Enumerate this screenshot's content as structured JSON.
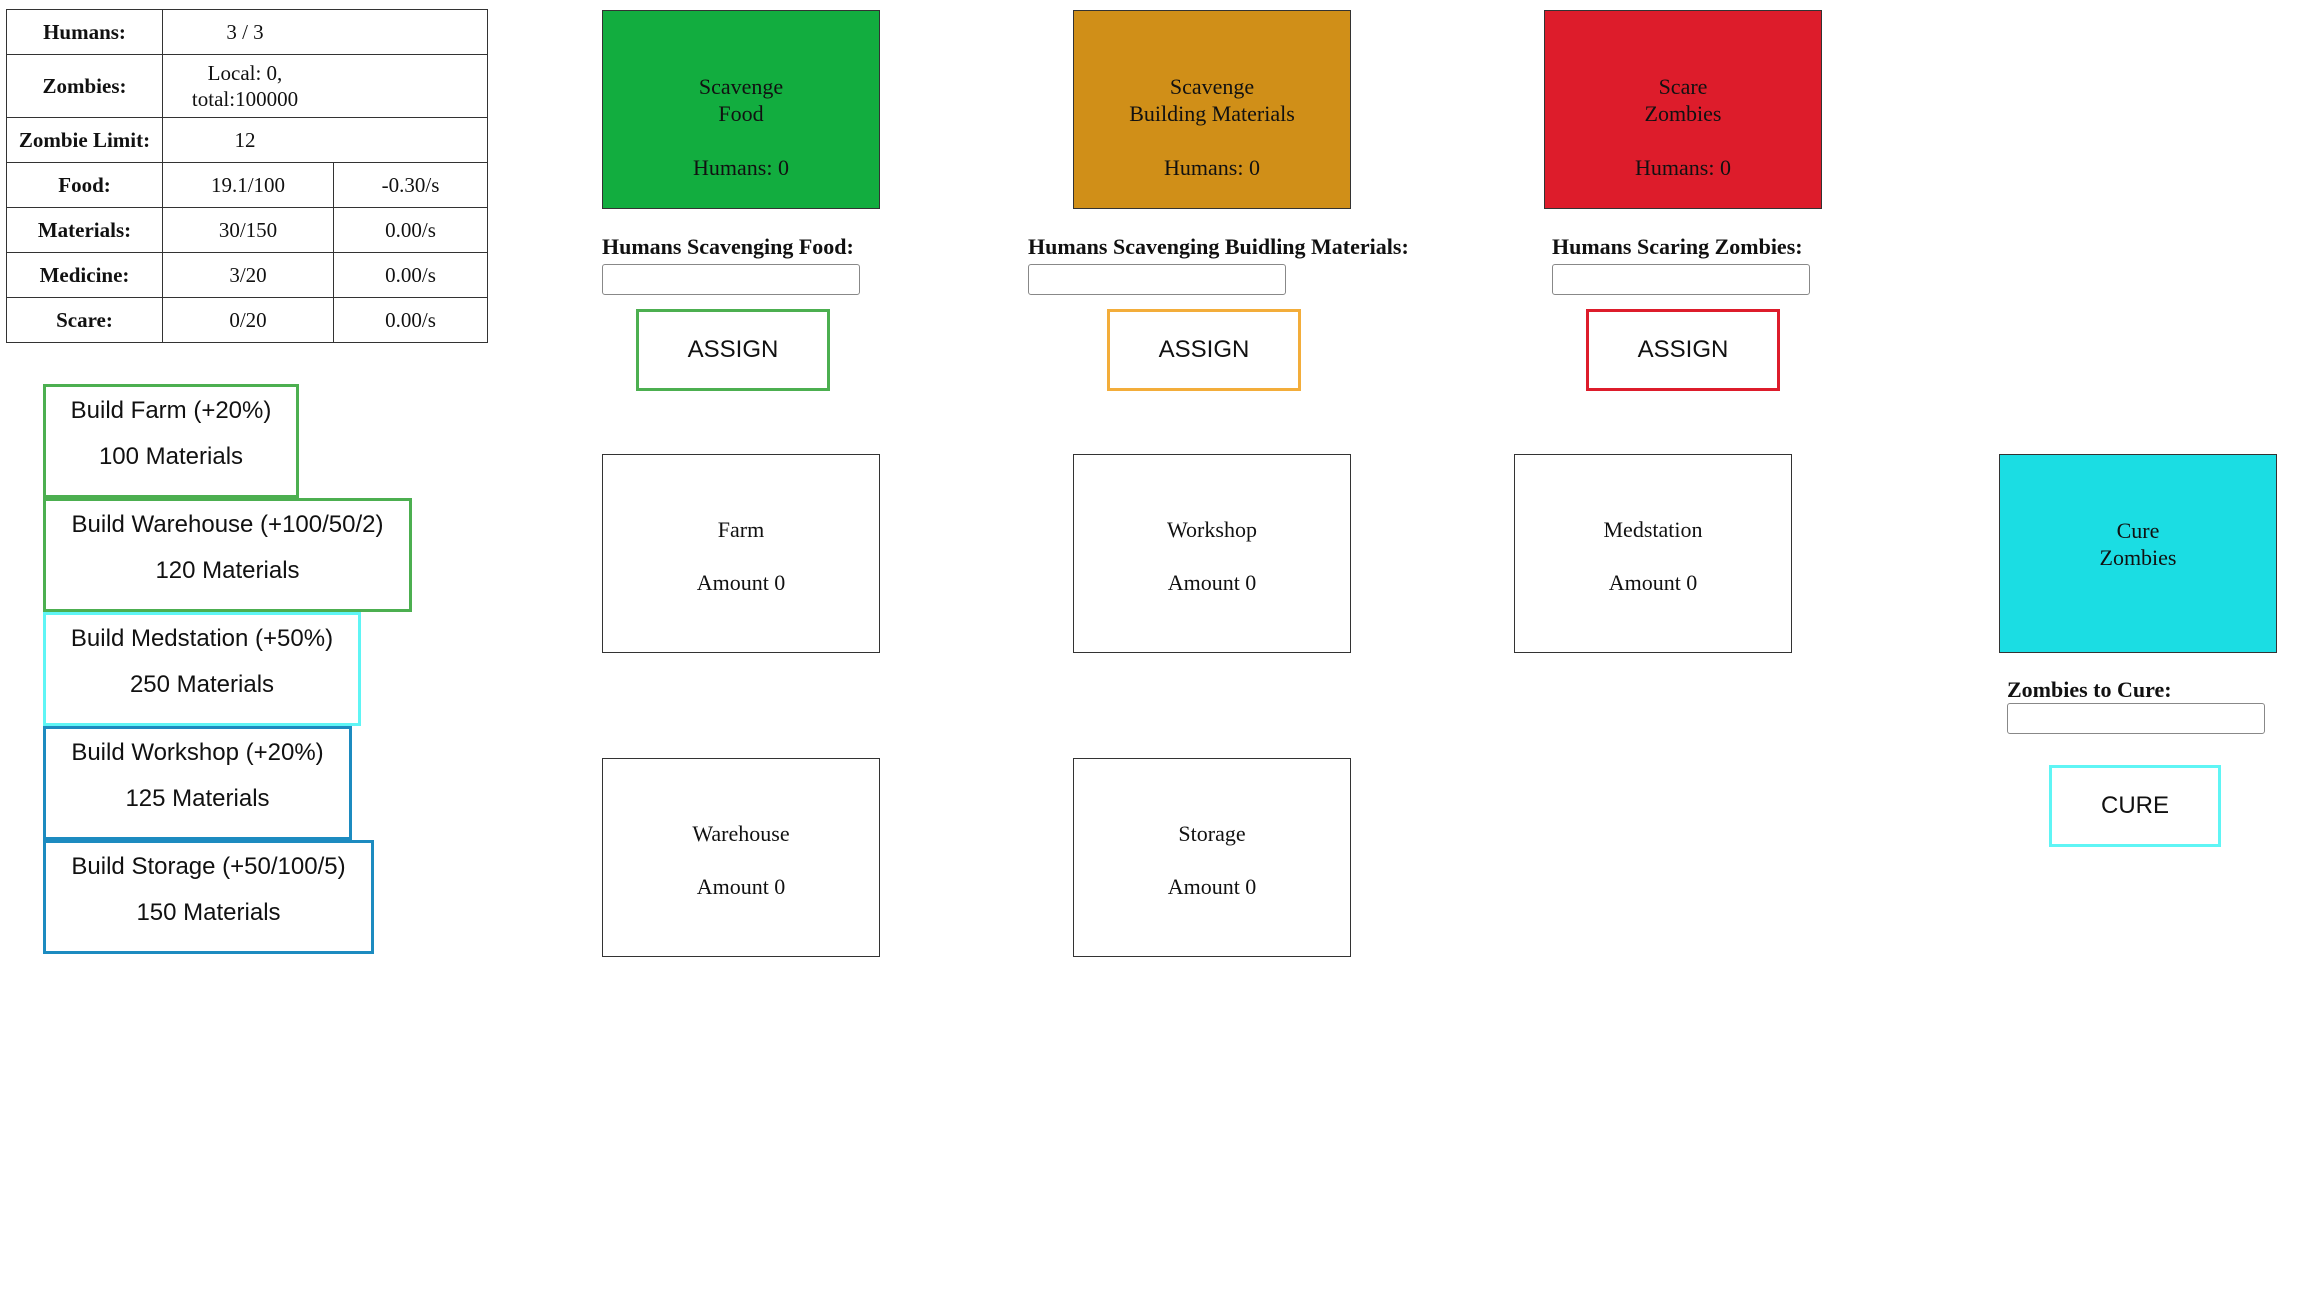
{
  "stats": {
    "humans": {
      "label": "Humans:",
      "value": "3 / 3"
    },
    "zombies": {
      "label": "Zombies:",
      "local": "Local: 0,",
      "total": "total:100000"
    },
    "zombie_limit": {
      "label": "Zombie Limit:",
      "value": "12"
    },
    "food": {
      "label": "Food:",
      "value": "19.1/100",
      "rate": "-0.30/s"
    },
    "materials": {
      "label": "Materials:",
      "value": "30/150",
      "rate": "0.00/s"
    },
    "medicine": {
      "label": "Medicine:",
      "value": "3/20",
      "rate": "0.00/s"
    },
    "scare": {
      "label": "Scare:",
      "value": "0/20",
      "rate": "0.00/s"
    }
  },
  "build": [
    {
      "title": "Build Farm (+20%)",
      "cost": "100 Materials",
      "border": "#4caf50"
    },
    {
      "title": "Build Warehouse (+100/50/2)",
      "cost": "120 Materials",
      "border": "#4caf50"
    },
    {
      "title": "Build Medstation (+50%)",
      "cost": "250 Materials",
      "border": "#5ff5f5"
    },
    {
      "title": "Build Workshop (+20%)",
      "cost": "125 Materials",
      "border": "#1c8bc0"
    },
    {
      "title": "Build Storage (+50/100/5)",
      "cost": "150 Materials",
      "border": "#1c8bc0"
    }
  ],
  "actions": {
    "food": {
      "line1": "Scavenge",
      "line2": "Food",
      "humans": "Humans: 0",
      "color": "#12ad3f",
      "label": "Humans Scavenging Food:",
      "button": "ASSIGN",
      "button_border": "#4caf50"
    },
    "materials": {
      "line1": "Scavenge",
      "line2": "Building Materials",
      "humans": "Humans: 0",
      "color": "#d08f18",
      "label": "Humans Scavenging Buidling Materials:",
      "button": "ASSIGN",
      "button_border": "#f3ad3a"
    },
    "scare": {
      "line1": "Scare",
      "line2": "Zombies",
      "humans": "Humans: 0",
      "color": "#dd1c2b",
      "label": "Humans Scaring Zombies:",
      "button": "ASSIGN",
      "button_border": "#dd1c2b"
    },
    "cure": {
      "line1": "Cure",
      "line2": "Zombies",
      "color": "#1bdde3",
      "label": "Zombies to Cure:",
      "button": "CURE",
      "button_border": "#5ff5f5"
    }
  },
  "buildings": {
    "farm": {
      "name": "Farm",
      "amount": "Amount 0"
    },
    "workshop": {
      "name": "Workshop",
      "amount": "Amount 0"
    },
    "medstation": {
      "name": "Medstation",
      "amount": "Amount 0"
    },
    "warehouse": {
      "name": "Warehouse",
      "amount": "Amount 0"
    },
    "storage": {
      "name": "Storage",
      "amount": "Amount 0"
    }
  }
}
